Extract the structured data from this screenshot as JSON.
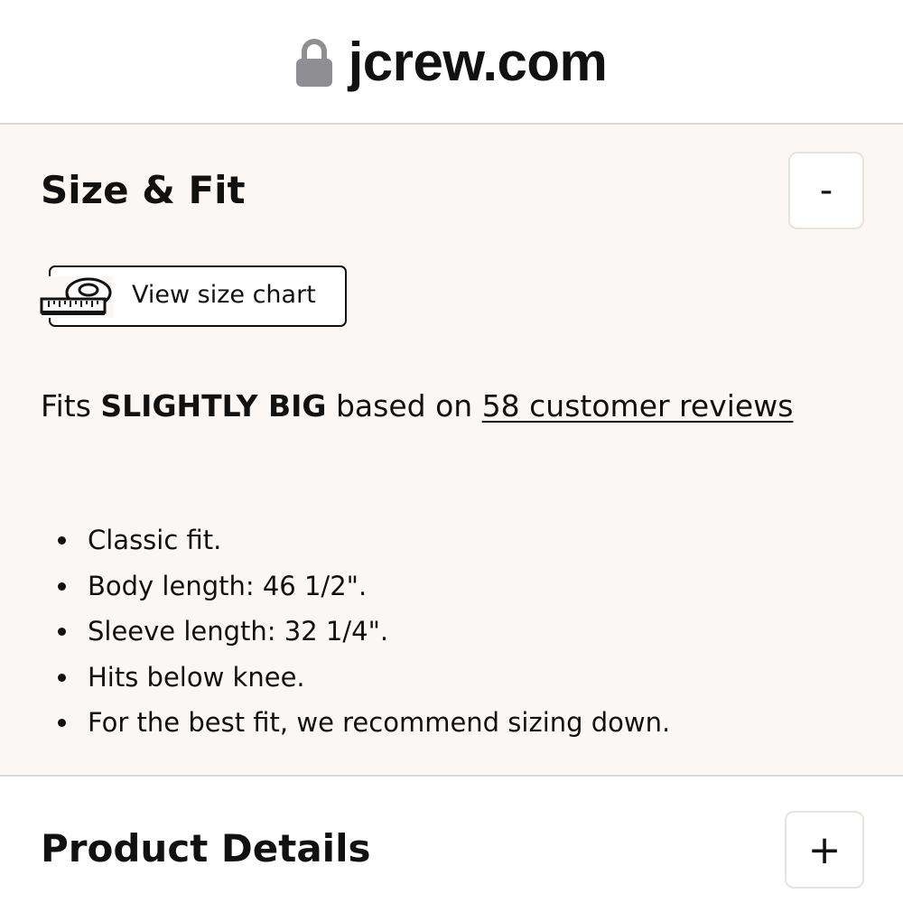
{
  "urlbar": {
    "domain": "jcrew.com",
    "lock_icon": "lock-icon"
  },
  "size_fit": {
    "title": "Size & Fit",
    "toggle_label": "-",
    "size_chart_button": {
      "icon": "measuring-tape-icon",
      "label": "View size chart"
    },
    "fit_summary": {
      "prefix": "Fits",
      "fit_value": "SLIGHTLY BIG",
      "middle": "based on",
      "reviews_link": "58 customer reviews"
    },
    "details": [
      "Classic fit.",
      "Body length: 46 1/2\".",
      "Sleeve length: 32 1/4\".",
      "Hits below knee.",
      "For the best fit, we recommend sizing down."
    ]
  },
  "product_details": {
    "title": "Product Details",
    "toggle_label": "+"
  },
  "colors": {
    "section_background": "#faf7f4",
    "text": "#111111",
    "lock_gray": "#8e8e93"
  }
}
